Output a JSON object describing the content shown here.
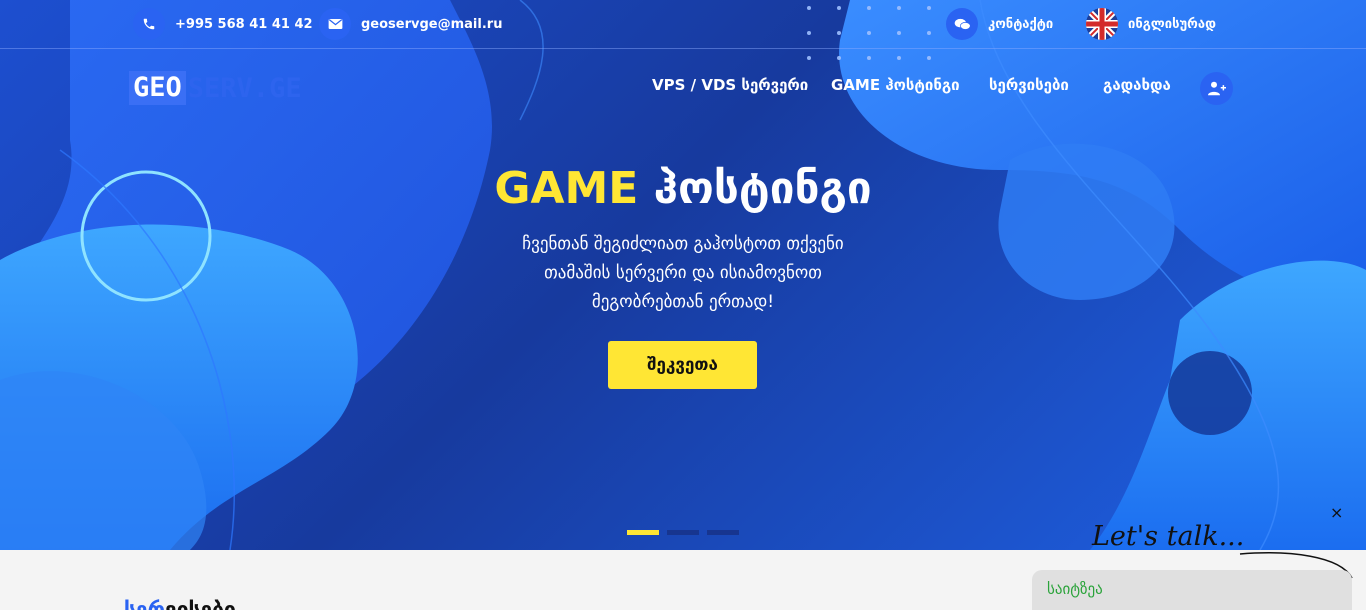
{
  "topbar": {
    "phone": "+995 568 41 41 42",
    "email": "geoservge@mail.ru",
    "contact_label": "კონტაქტი",
    "language_label": "ინგლისურად"
  },
  "logo": {
    "part1": "GEO",
    "part2": "SERV.GE"
  },
  "nav": {
    "items": [
      {
        "label": "VPS / VDS სერვერი"
      },
      {
        "label": "GAME ჰოსტინგი"
      },
      {
        "label": "სერვისები"
      },
      {
        "label": "გადახდა"
      }
    ]
  },
  "hero": {
    "title_highlight": "GAME",
    "title_rest": "ჰოსტინგი",
    "subtitle_line1": "ჩვენთან შეგიძლიათ გაჰოსტოთ თქვენი",
    "subtitle_line2": "თამაშის სერვერი და ისიამოვნოთ",
    "subtitle_line3": "მეგობრებთან ერთად!",
    "button_label": "შეკვეთა"
  },
  "slider": {
    "slide_count": 3,
    "active_index": 0
  },
  "section": {
    "title_accent": "სერ",
    "title_rest": "ვისები"
  },
  "chat": {
    "title": "Let's talk...",
    "close_label": "×",
    "input_text": "საიტზეა"
  },
  "colors": {
    "accent": "#2a63f2",
    "highlight": "#ffe634",
    "hero_bg": "#1d4fd0"
  }
}
